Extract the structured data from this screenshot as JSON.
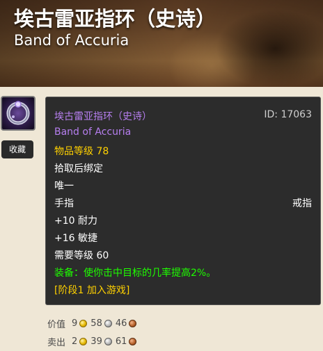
{
  "header": {
    "title": "埃古雷亚指环（史诗）",
    "subtitle": "Band of Accuria"
  },
  "actions": {
    "favorite_label": "收藏"
  },
  "tooltip": {
    "name_cn": "埃古雷亚指环（史诗）",
    "id_text": "ID: 17063",
    "name_en": "Band of Accuria",
    "item_level": "物品等级 78",
    "bind": "拾取后绑定",
    "unique": "唯一",
    "slot": "手指",
    "type": "戒指",
    "stat_stamina": "+10 耐力",
    "stat_agility": "+16 敏捷",
    "required_level": "需要等级 60",
    "equip_effect": "装备：使你击中目标的几率提高2%。",
    "phase": "[阶段1 加入游戏]"
  },
  "price": {
    "value": {
      "label": "价值",
      "gold": "9",
      "silver": "58",
      "copper": "46"
    },
    "sell": {
      "label": "卖出",
      "gold": "2",
      "silver": "39",
      "copper": "61"
    }
  },
  "colors": {
    "epic_purple": "#b77ff0",
    "item_level_yellow": "#ffd100",
    "equip_green": "#1eff00",
    "tooltip_bg": "#2c2c2c",
    "page_bg": "#efe7d6"
  },
  "icons": {
    "item": "ring-icon",
    "gold": "gold-coin-icon",
    "silver": "silver-coin-icon",
    "copper": "copper-coin-icon"
  }
}
